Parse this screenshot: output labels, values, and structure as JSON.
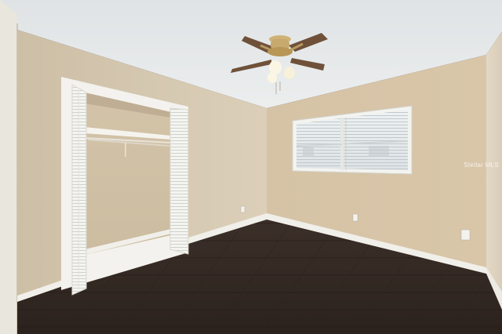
{
  "scene": {
    "description_free": true,
    "watermark_text": "Stellar MLS",
    "colors": {
      "ceiling": "#e6e9ea",
      "wall_left": "#d8cdb8",
      "wall_back": "#dcc9ae",
      "wall_right": "#e1d6c4",
      "floor": "#3a2e27",
      "trim": "#f2f1ec",
      "fan_brass": "#c8a86a",
      "fan_blade": "#7a5a3f"
    },
    "icons": [
      "ceiling-fan-icon",
      "window-icon",
      "closet-door-icon",
      "outlet-icon"
    ]
  }
}
